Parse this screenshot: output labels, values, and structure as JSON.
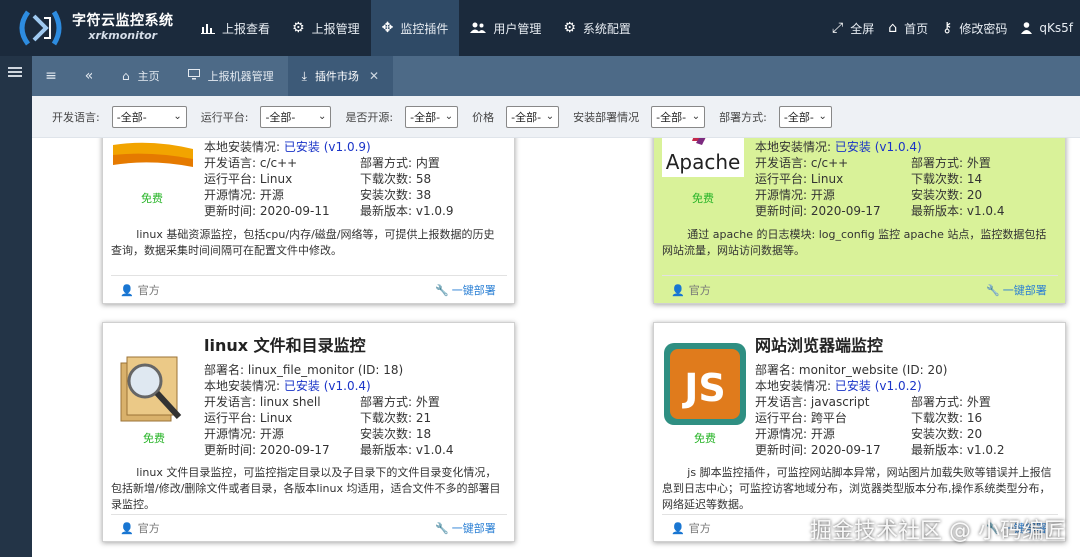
{
  "app": {
    "title": "字符云监控系统",
    "subtitle": "xrkmonitor"
  },
  "nav": {
    "items": [
      {
        "label": "上报查看",
        "icon": "bar-chart-icon"
      },
      {
        "label": "上报管理",
        "icon": "cogs-icon"
      },
      {
        "label": "监控插件",
        "icon": "move-icon"
      },
      {
        "label": "用户管理",
        "icon": "users-icon"
      },
      {
        "label": "系统配置",
        "icon": "gear-icon"
      }
    ],
    "right": [
      {
        "label": "全屏",
        "icon": "fullscreen-icon"
      },
      {
        "label": "首页",
        "icon": "home-icon"
      },
      {
        "label": "修改密码",
        "icon": "key-icon"
      },
      {
        "label": "qKs5f",
        "icon": "user-icon"
      }
    ]
  },
  "tabs": [
    {
      "label": "主页",
      "icon": "home-icon"
    },
    {
      "label": "上报机器管理",
      "icon": "desktop-icon"
    },
    {
      "label": "插件市场",
      "icon": "download-icon",
      "close": "✕"
    }
  ],
  "filters": [
    {
      "label": "开发语言:",
      "value": "-全部-"
    },
    {
      "label": "运行平台:",
      "value": "-全部-"
    },
    {
      "label": "是否开源:",
      "value": "-全部-"
    },
    {
      "label": "价格",
      "value": "-全部-"
    },
    {
      "label": "安装部署情况",
      "value": "-全部-"
    },
    {
      "label": "部署方式:",
      "value": "-全部-"
    }
  ],
  "plugins": [
    {
      "title": "",
      "free": "免费",
      "install_label": "本地安装情况:",
      "install_status": "已安装",
      "install_ver": "(v1.0.9)",
      "lang_label": "开发语言:",
      "lang": "c/c++",
      "deploy_label": "部署方式:",
      "deploy": "内置",
      "platform_label": "运行平台:",
      "platform": "Linux",
      "downloads_label": "下载次数:",
      "downloads": "58",
      "open_label": "开源情况:",
      "open": "开源",
      "installs_label": "安装次数:",
      "installs": "38",
      "updated_label": "更新时间:",
      "updated": "2020-09-11",
      "latest_label": "最新版本:",
      "latest": "v1.0.9",
      "desc": "linux 基础资源监控，包括cpu/内存/磁盘/网络等，可提供上报数据的历史查询，数据采集时间间隔可在配置文件中修改。",
      "official": "官方",
      "deploy_btn": "一键部署"
    },
    {
      "title": "",
      "free": "免费",
      "install_label": "本地安装情况:",
      "install_status": "已安装",
      "install_ver": "(v1.0.4)",
      "lang_label": "开发语言:",
      "lang": "c/c++",
      "deploy_label": "部署方式:",
      "deploy": "外置",
      "platform_label": "运行平台:",
      "platform": "Linux",
      "downloads_label": "下载次数:",
      "downloads": "14",
      "open_label": "开源情况:",
      "open": "开源",
      "installs_label": "安装次数:",
      "installs": "20",
      "updated_label": "更新时间:",
      "updated": "2020-09-17",
      "latest_label": "最新版本:",
      "latest": "v1.0.4",
      "desc": "通过 apache 的日志模块: log_config 监控 apache 站点，监控数据包括网站流量，网站访问数据等。",
      "official": "官方",
      "deploy_btn": "一键部署",
      "thumb_text": "Apache"
    },
    {
      "title": "linux 文件和目录监控",
      "free": "免费",
      "name_label": "部署名:",
      "name": "linux_file_monitor (ID: 18)",
      "install_label": "本地安装情况:",
      "install_status": "已安装",
      "install_ver": "(v1.0.4)",
      "lang_label": "开发语言:",
      "lang": "linux shell",
      "deploy_label": "部署方式:",
      "deploy": "外置",
      "platform_label": "运行平台:",
      "platform": "Linux",
      "downloads_label": "下载次数:",
      "downloads": "21",
      "open_label": "开源情况:",
      "open": "开源",
      "installs_label": "安装次数:",
      "installs": "18",
      "updated_label": "更新时间:",
      "updated": "2020-09-17",
      "latest_label": "最新版本:",
      "latest": "v1.0.4",
      "desc": "linux 文件目录监控，可监控指定目录以及子目录下的文件目录变化情况，包括新增/修改/删除文件或者目录，各版本linux 均适用，适合文件不多的部署目录监控。",
      "official": "官方",
      "deploy_btn": "一键部署"
    },
    {
      "title": "网站浏览器端监控",
      "free": "免费",
      "name_label": "部署名:",
      "name": "monitor_website (ID: 20)",
      "install_label": "本地安装情况:",
      "install_status": "已安装",
      "install_ver": "(v1.0.2)",
      "lang_label": "开发语言:",
      "lang": "javascript",
      "deploy_label": "部署方式:",
      "deploy": "外置",
      "platform_label": "运行平台:",
      "platform": "跨平台",
      "downloads_label": "下载次数:",
      "downloads": "16",
      "open_label": "开源情况:",
      "open": "开源",
      "installs_label": "安装次数:",
      "installs": "20",
      "updated_label": "更新时间:",
      "updated": "2020-09-17",
      "latest_label": "最新版本:",
      "latest": "v1.0.2",
      "desc": "js 脚本监控插件，可监控网站脚本异常，网站图片加载失败等错误并上报信息到日志中心；可监控访客地域分布，浏览器类型版本分布,操作系统类型分布，网络延迟等数据。",
      "official": "官方",
      "deploy_btn": "一键部署",
      "thumb_text": "JS"
    }
  ],
  "watermark": "掘金技术社区 @ 小码编匠",
  "colors": {
    "topbar": "#1b2a3c",
    "tabbar": "#4d6a87",
    "highlight_card": "#d9f299",
    "free": "#28b428",
    "link": "#1a34c8"
  }
}
